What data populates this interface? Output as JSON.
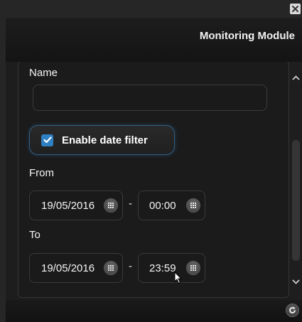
{
  "window": {
    "title": "Monitoring Module"
  },
  "form": {
    "name_label": "Name",
    "name_value": "",
    "date_filter_label": "Enable date filter",
    "date_filter_checked": true,
    "from_label": "From",
    "from_date": "19/05/2016",
    "from_time": "00:00",
    "to_label": "To",
    "to_date": "19/05/2016",
    "to_time": "23:59",
    "range_separator": "-"
  },
  "colors": {
    "accent": "#2f7fc4",
    "background": "#1b1b1b",
    "header": "#141414"
  },
  "icons": {
    "close": "close-icon",
    "calendar": "calendar-grid-icon",
    "clock": "clock-grid-icon",
    "refresh": "refresh-icon",
    "scroll_up": "chevron-up-icon",
    "scroll_down": "chevron-down-icon",
    "check": "check-icon",
    "cursor": "mouse-cursor-icon"
  }
}
